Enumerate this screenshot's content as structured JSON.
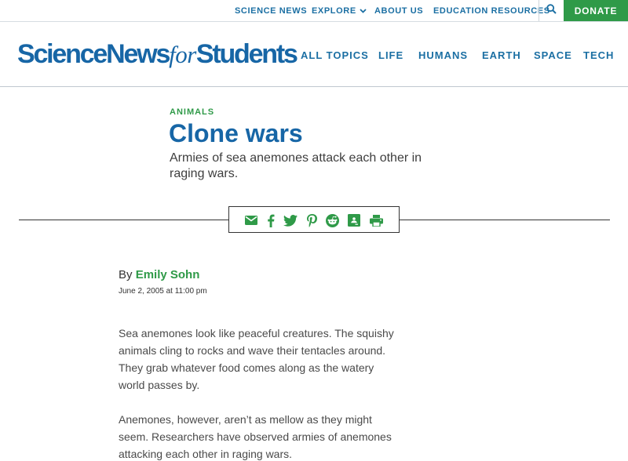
{
  "utility_nav": {
    "items": [
      {
        "label": "SCIENCE NEWS"
      },
      {
        "label": "EXPLORE"
      },
      {
        "label": "ABOUT US"
      },
      {
        "label": "EDUCATION RESOURCES"
      }
    ],
    "search_icon": "search-icon",
    "donate_label": "DONATE"
  },
  "logo": {
    "part1": "ScienceNews",
    "part2": "for",
    "part3": "Students"
  },
  "main_nav": {
    "items": [
      {
        "label": "ALL TOPICS"
      },
      {
        "label": "LIFE"
      },
      {
        "label": "HUMANS"
      },
      {
        "label": "EARTH"
      },
      {
        "label": "SPACE"
      },
      {
        "label": "TECH"
      }
    ]
  },
  "article": {
    "kicker": "ANIMALS",
    "title": "Clone wars",
    "dek": "Armies of sea anemones attack each other in raging wars.",
    "byline_prefix": "By",
    "author": "Emily Sohn",
    "date": "June 2, 2005 at 11:00 pm",
    "paragraphs": [
      "Sea anemones look like peaceful creatures. The squishy animals cling to rocks and wave their tentacles around. They grab whatever food comes along as the watery world passes by.",
      "Anemones, however, aren’t as mellow as they might seem. Researchers have observed armies of anemones attacking each other in raging wars."
    ]
  },
  "share": {
    "icons": [
      "email-icon",
      "facebook-icon",
      "twitter-icon",
      "pinterest-icon",
      "reddit-icon",
      "google-classroom-icon",
      "print-icon"
    ]
  },
  "colors": {
    "brand_blue": "#1766a6",
    "link_blue": "#1b6fa3",
    "accent_green": "#2f9a48"
  }
}
